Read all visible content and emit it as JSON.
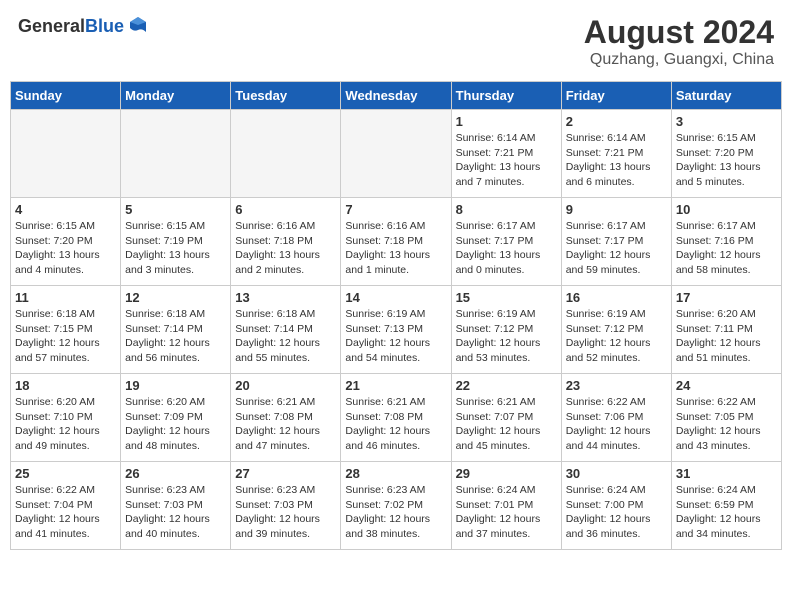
{
  "header": {
    "logo_general": "General",
    "logo_blue": "Blue",
    "month_year": "August 2024",
    "location": "Quzhang, Guangxi, China"
  },
  "weekdays": [
    "Sunday",
    "Monday",
    "Tuesday",
    "Wednesday",
    "Thursday",
    "Friday",
    "Saturday"
  ],
  "weeks": [
    [
      {
        "day": "",
        "info": ""
      },
      {
        "day": "",
        "info": ""
      },
      {
        "day": "",
        "info": ""
      },
      {
        "day": "",
        "info": ""
      },
      {
        "day": "1",
        "info": "Sunrise: 6:14 AM\nSunset: 7:21 PM\nDaylight: 13 hours\nand 7 minutes."
      },
      {
        "day": "2",
        "info": "Sunrise: 6:14 AM\nSunset: 7:21 PM\nDaylight: 13 hours\nand 6 minutes."
      },
      {
        "day": "3",
        "info": "Sunrise: 6:15 AM\nSunset: 7:20 PM\nDaylight: 13 hours\nand 5 minutes."
      }
    ],
    [
      {
        "day": "4",
        "info": "Sunrise: 6:15 AM\nSunset: 7:20 PM\nDaylight: 13 hours\nand 4 minutes."
      },
      {
        "day": "5",
        "info": "Sunrise: 6:15 AM\nSunset: 7:19 PM\nDaylight: 13 hours\nand 3 minutes."
      },
      {
        "day": "6",
        "info": "Sunrise: 6:16 AM\nSunset: 7:18 PM\nDaylight: 13 hours\nand 2 minutes."
      },
      {
        "day": "7",
        "info": "Sunrise: 6:16 AM\nSunset: 7:18 PM\nDaylight: 13 hours\nand 1 minute."
      },
      {
        "day": "8",
        "info": "Sunrise: 6:17 AM\nSunset: 7:17 PM\nDaylight: 13 hours\nand 0 minutes."
      },
      {
        "day": "9",
        "info": "Sunrise: 6:17 AM\nSunset: 7:17 PM\nDaylight: 12 hours\nand 59 minutes."
      },
      {
        "day": "10",
        "info": "Sunrise: 6:17 AM\nSunset: 7:16 PM\nDaylight: 12 hours\nand 58 minutes."
      }
    ],
    [
      {
        "day": "11",
        "info": "Sunrise: 6:18 AM\nSunset: 7:15 PM\nDaylight: 12 hours\nand 57 minutes."
      },
      {
        "day": "12",
        "info": "Sunrise: 6:18 AM\nSunset: 7:14 PM\nDaylight: 12 hours\nand 56 minutes."
      },
      {
        "day": "13",
        "info": "Sunrise: 6:18 AM\nSunset: 7:14 PM\nDaylight: 12 hours\nand 55 minutes."
      },
      {
        "day": "14",
        "info": "Sunrise: 6:19 AM\nSunset: 7:13 PM\nDaylight: 12 hours\nand 54 minutes."
      },
      {
        "day": "15",
        "info": "Sunrise: 6:19 AM\nSunset: 7:12 PM\nDaylight: 12 hours\nand 53 minutes."
      },
      {
        "day": "16",
        "info": "Sunrise: 6:19 AM\nSunset: 7:12 PM\nDaylight: 12 hours\nand 52 minutes."
      },
      {
        "day": "17",
        "info": "Sunrise: 6:20 AM\nSunset: 7:11 PM\nDaylight: 12 hours\nand 51 minutes."
      }
    ],
    [
      {
        "day": "18",
        "info": "Sunrise: 6:20 AM\nSunset: 7:10 PM\nDaylight: 12 hours\nand 49 minutes."
      },
      {
        "day": "19",
        "info": "Sunrise: 6:20 AM\nSunset: 7:09 PM\nDaylight: 12 hours\nand 48 minutes."
      },
      {
        "day": "20",
        "info": "Sunrise: 6:21 AM\nSunset: 7:08 PM\nDaylight: 12 hours\nand 47 minutes."
      },
      {
        "day": "21",
        "info": "Sunrise: 6:21 AM\nSunset: 7:08 PM\nDaylight: 12 hours\nand 46 minutes."
      },
      {
        "day": "22",
        "info": "Sunrise: 6:21 AM\nSunset: 7:07 PM\nDaylight: 12 hours\nand 45 minutes."
      },
      {
        "day": "23",
        "info": "Sunrise: 6:22 AM\nSunset: 7:06 PM\nDaylight: 12 hours\nand 44 minutes."
      },
      {
        "day": "24",
        "info": "Sunrise: 6:22 AM\nSunset: 7:05 PM\nDaylight: 12 hours\nand 43 minutes."
      }
    ],
    [
      {
        "day": "25",
        "info": "Sunrise: 6:22 AM\nSunset: 7:04 PM\nDaylight: 12 hours\nand 41 minutes."
      },
      {
        "day": "26",
        "info": "Sunrise: 6:23 AM\nSunset: 7:03 PM\nDaylight: 12 hours\nand 40 minutes."
      },
      {
        "day": "27",
        "info": "Sunrise: 6:23 AM\nSunset: 7:03 PM\nDaylight: 12 hours\nand 39 minutes."
      },
      {
        "day": "28",
        "info": "Sunrise: 6:23 AM\nSunset: 7:02 PM\nDaylight: 12 hours\nand 38 minutes."
      },
      {
        "day": "29",
        "info": "Sunrise: 6:24 AM\nSunset: 7:01 PM\nDaylight: 12 hours\nand 37 minutes."
      },
      {
        "day": "30",
        "info": "Sunrise: 6:24 AM\nSunset: 7:00 PM\nDaylight: 12 hours\nand 36 minutes."
      },
      {
        "day": "31",
        "info": "Sunrise: 6:24 AM\nSunset: 6:59 PM\nDaylight: 12 hours\nand 34 minutes."
      }
    ]
  ]
}
